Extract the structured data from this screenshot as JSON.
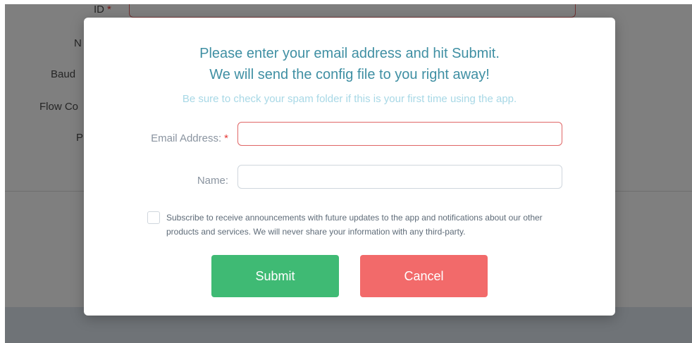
{
  "background_form": {
    "id_label": "ID",
    "required_mark": "*",
    "labels": [
      "N",
      "Baud",
      "Flow Co",
      "P"
    ]
  },
  "modal": {
    "title_line1": "Please enter your email address and hit Submit.",
    "title_line2": "We will send the config file to you right away!",
    "subtitle": "Be sure to check your spam folder if this is your first time using the app.",
    "email": {
      "label": "Email Address:",
      "required_mark": "*",
      "value": ""
    },
    "name": {
      "label": "Name:",
      "value": ""
    },
    "subscribe": {
      "checked": false,
      "text": "Subscribe to receive announcements with future updates to the app and notifications about our other products and services. We will never share your information with any third-party."
    },
    "submit_label": "Submit",
    "cancel_label": "Cancel"
  },
  "colors": {
    "title": "#3f8fa3",
    "subtitle": "#a8d8e6",
    "submit": "#3fba74",
    "cancel": "#f26a6a",
    "required": "#e53935"
  }
}
